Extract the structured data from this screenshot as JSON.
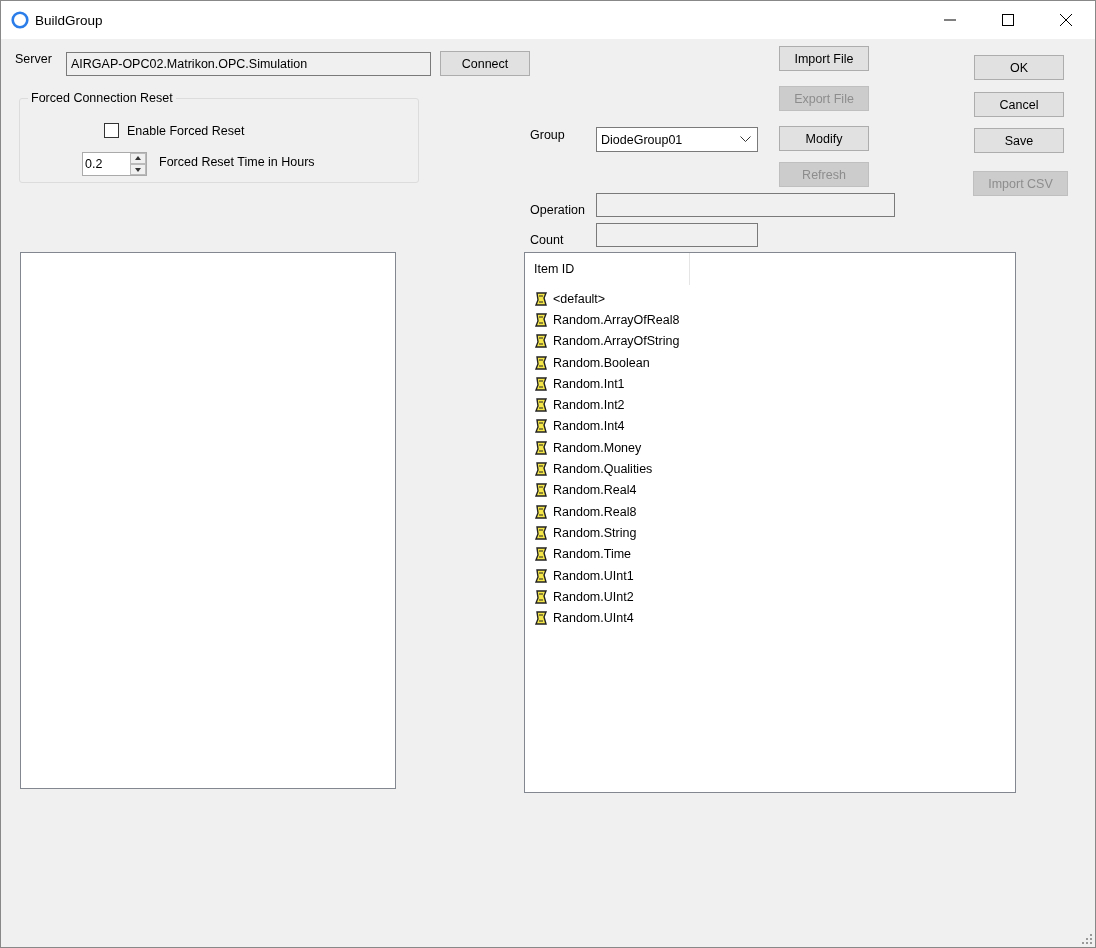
{
  "window": {
    "title": "BuildGroup"
  },
  "server": {
    "label": "Server",
    "value": "AIRGAP-OPC02.Matrikon.OPC.Simulation",
    "connect_button": {
      "label": "Connect",
      "disabled": false
    }
  },
  "forced_reset": {
    "legend": "Forced Connection Reset",
    "enable": {
      "label": "Enable Forced Reset",
      "checked": false
    },
    "time": {
      "value": "0.2",
      "label": "Forced Reset Time in Hours"
    }
  },
  "file_buttons": [
    {
      "label": "Import File",
      "disabled": false
    },
    {
      "label": "Export File",
      "disabled": true
    },
    {
      "label": "Modify",
      "disabled": false
    },
    {
      "label": "Refresh",
      "disabled": true
    }
  ],
  "group": {
    "label": "Group",
    "value": "DiodeGroup01"
  },
  "operation": {
    "label": "Operation"
  },
  "count": {
    "label": "Count"
  },
  "dialog_buttons": [
    {
      "label": "OK",
      "disabled": false
    },
    {
      "label": "Cancel",
      "disabled": false
    },
    {
      "label": "Save",
      "disabled": false
    },
    {
      "label": "Import CSV",
      "disabled": true
    }
  ],
  "items": {
    "columns": [
      "Item ID"
    ],
    "rows": [
      "<default>",
      "Random.ArrayOfReal8",
      "Random.ArrayOfString",
      "Random.Boolean",
      "Random.Int1",
      "Random.Int2",
      "Random.Int4",
      "Random.Money",
      "Random.Qualities",
      "Random.Real4",
      "Random.Real8",
      "Random.String",
      "Random.Time",
      "Random.UInt1",
      "Random.UInt2",
      "Random.UInt4"
    ]
  }
}
